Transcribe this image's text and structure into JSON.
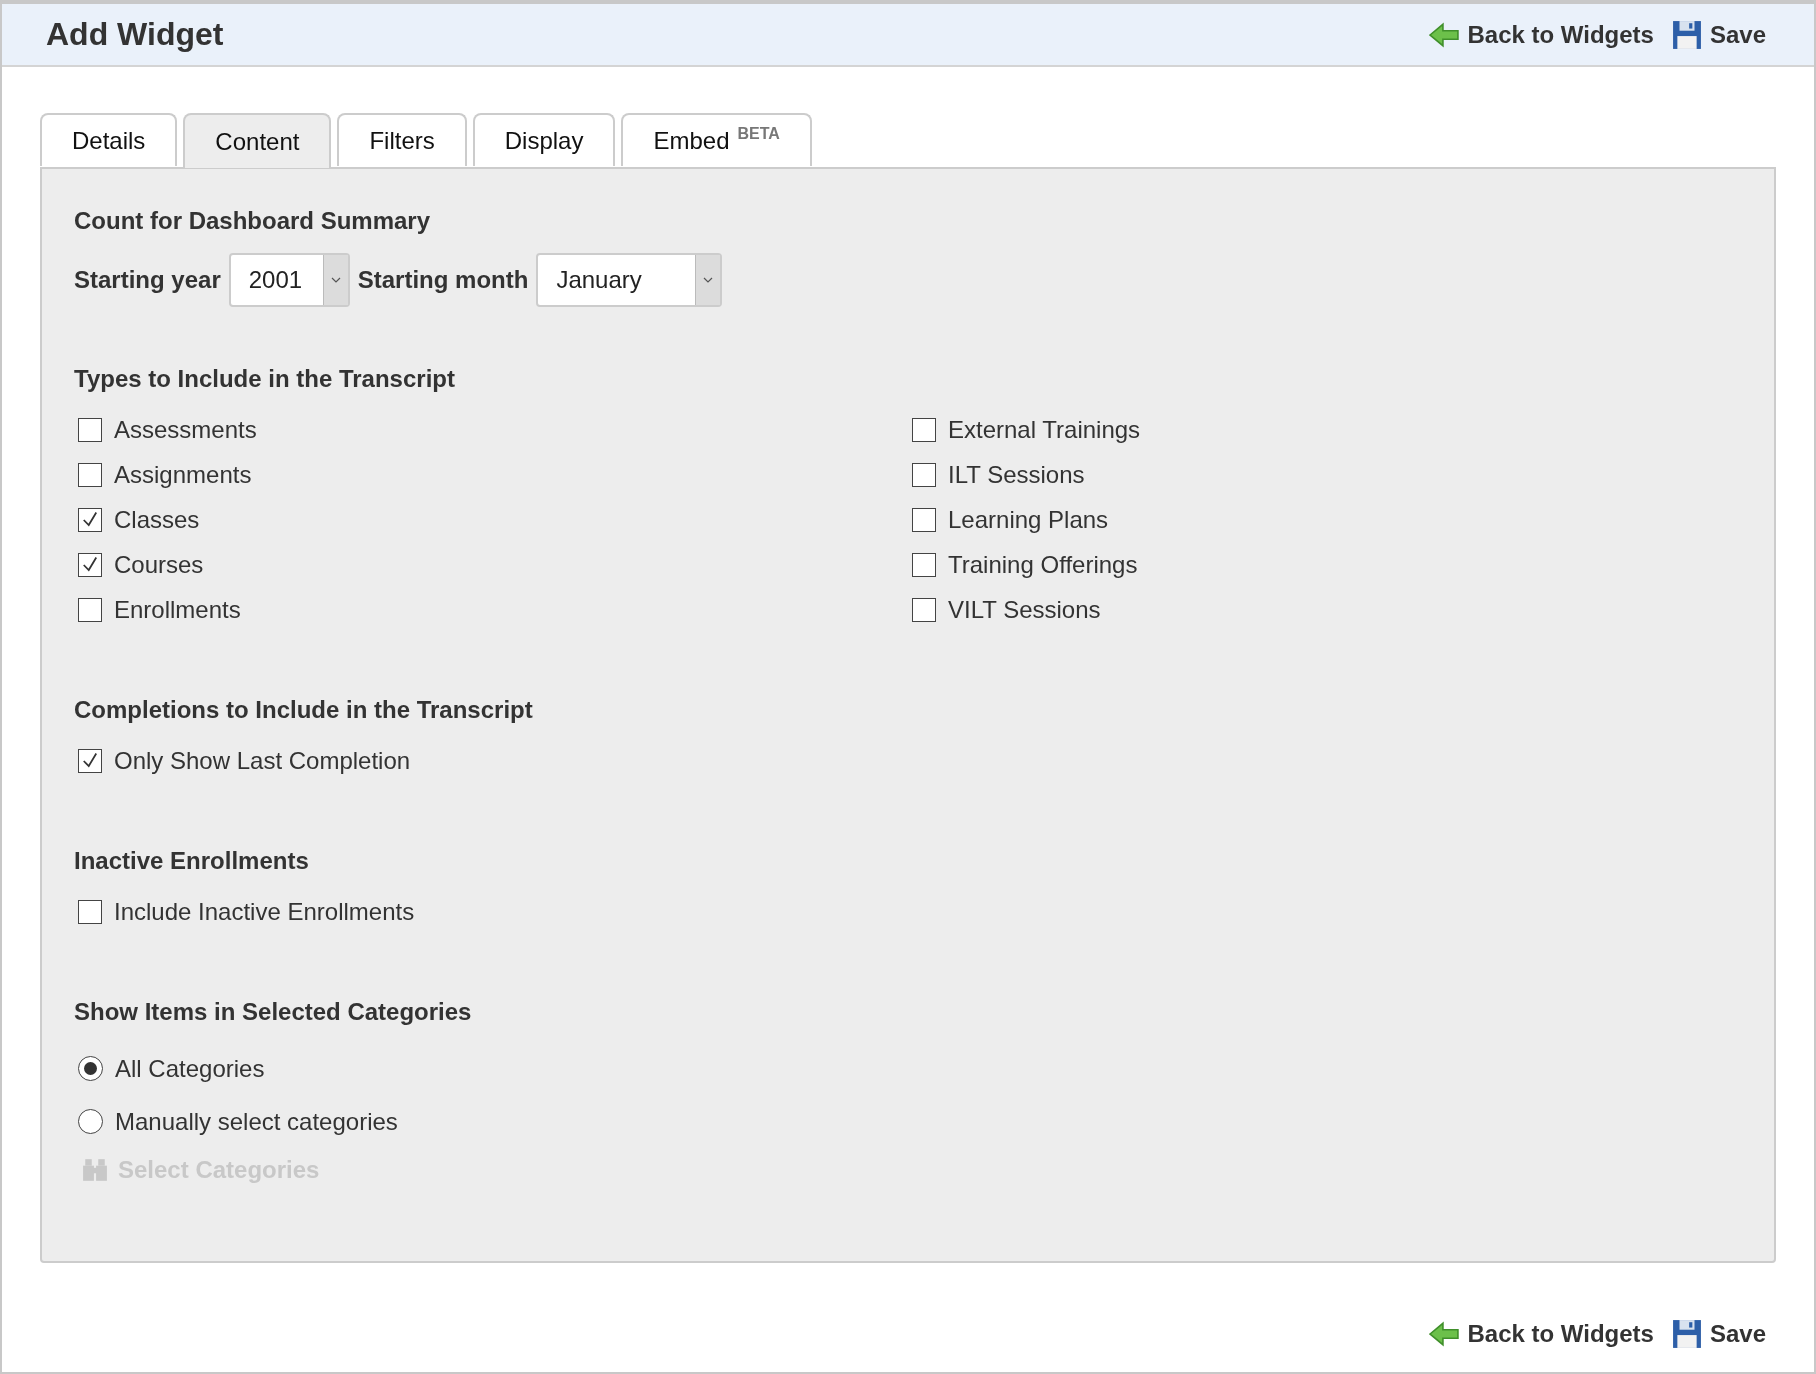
{
  "header": {
    "title": "Add Widget",
    "actions": [
      {
        "kind": "back",
        "label": "Back to Widgets"
      },
      {
        "kind": "save",
        "label": "Save"
      }
    ]
  },
  "tabs": [
    {
      "label": "Details",
      "selected": false
    },
    {
      "label": "Content",
      "selected": true
    },
    {
      "label": "Filters",
      "selected": false
    },
    {
      "label": "Display",
      "selected": false
    },
    {
      "label": "Embed",
      "badge": "BETA",
      "selected": false
    }
  ],
  "sections": [
    {
      "kind": "selects",
      "title": "Count for Dashboard Summary",
      "fields": [
        {
          "label": "Starting year",
          "value": "2001"
        },
        {
          "label": "Starting month",
          "value": "January"
        }
      ]
    },
    {
      "kind": "checkboxes",
      "title": "Types to Include in the Transcript",
      "columns": [
        [
          {
            "label": "Assessments",
            "checked": false
          },
          {
            "label": "Assignments",
            "checked": false
          },
          {
            "label": "Classes",
            "checked": true
          },
          {
            "label": "Courses",
            "checked": true
          },
          {
            "label": "Enrollments",
            "checked": false
          }
        ],
        [
          {
            "label": "External Trainings",
            "checked": false
          },
          {
            "label": "ILT Sessions",
            "checked": false
          },
          {
            "label": "Learning Plans",
            "checked": false
          },
          {
            "label": "Training Offerings",
            "checked": false
          },
          {
            "label": "VILT Sessions",
            "checked": false
          }
        ]
      ]
    },
    {
      "kind": "checkboxes",
      "title": "Completions to Include in the Transcript",
      "columns": [
        [
          {
            "label": "Only Show Last Completion",
            "checked": true
          }
        ]
      ]
    },
    {
      "kind": "checkboxes",
      "title": "Inactive Enrollments",
      "columns": [
        [
          {
            "label": "Include Inactive Enrollments",
            "checked": false
          }
        ]
      ]
    },
    {
      "kind": "radios",
      "title": "Show Items in Selected Categories",
      "options": [
        {
          "label": "All Categories",
          "selected": true
        },
        {
          "label": "Manually select categories",
          "selected": false
        }
      ],
      "button": {
        "label": "Select Categories",
        "disabled": true
      }
    }
  ],
  "footer_actions": [
    {
      "kind": "back",
      "label": "Back to Widgets"
    },
    {
      "kind": "save",
      "label": "Save"
    }
  ]
}
